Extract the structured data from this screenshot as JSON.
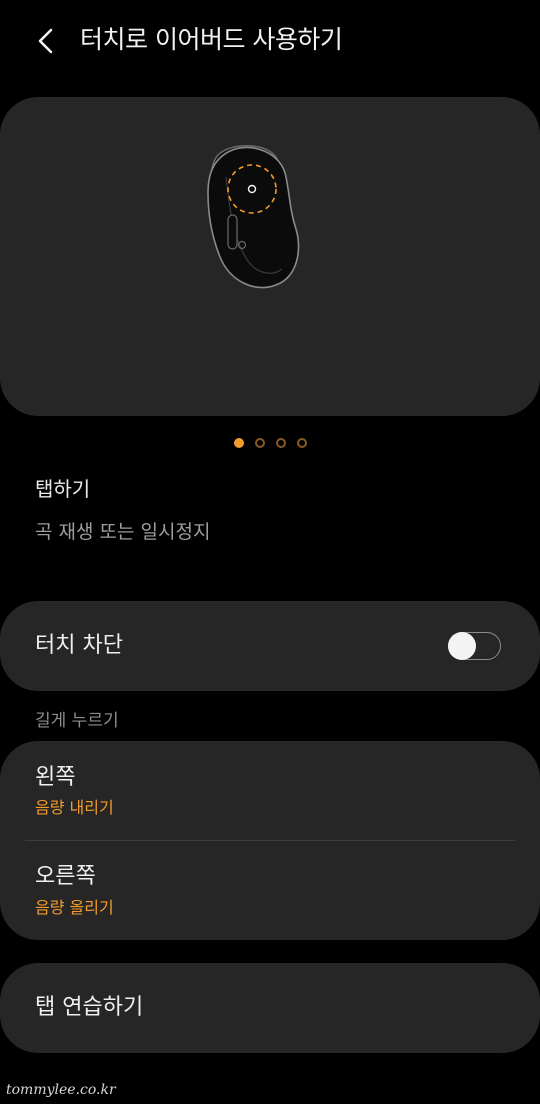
{
  "header": {
    "title": "터치로 이어버드 사용하기",
    "back_icon": "chevron-left-icon"
  },
  "illustration": {
    "image": "earbud-touch-area-illustration",
    "pages": 4,
    "active_page": 1
  },
  "gesture": {
    "title": "탭하기",
    "description": "곡 재생 또는 일시정지"
  },
  "block_touch": {
    "label": "터치 차단",
    "enabled": false
  },
  "long_press": {
    "section_label": "길게 누르기",
    "left": {
      "title": "왼쪽",
      "value": "음량 내리기"
    },
    "right": {
      "title": "오른쪽",
      "value": "음량 올리기"
    }
  },
  "practice": {
    "label": "탭 연습하기"
  },
  "watermark": "tommylee.co.kr",
  "colors": {
    "background": "#000000",
    "card": "#262626",
    "accent": "#f39c2c",
    "secondary_text": "#9e9e9e"
  }
}
